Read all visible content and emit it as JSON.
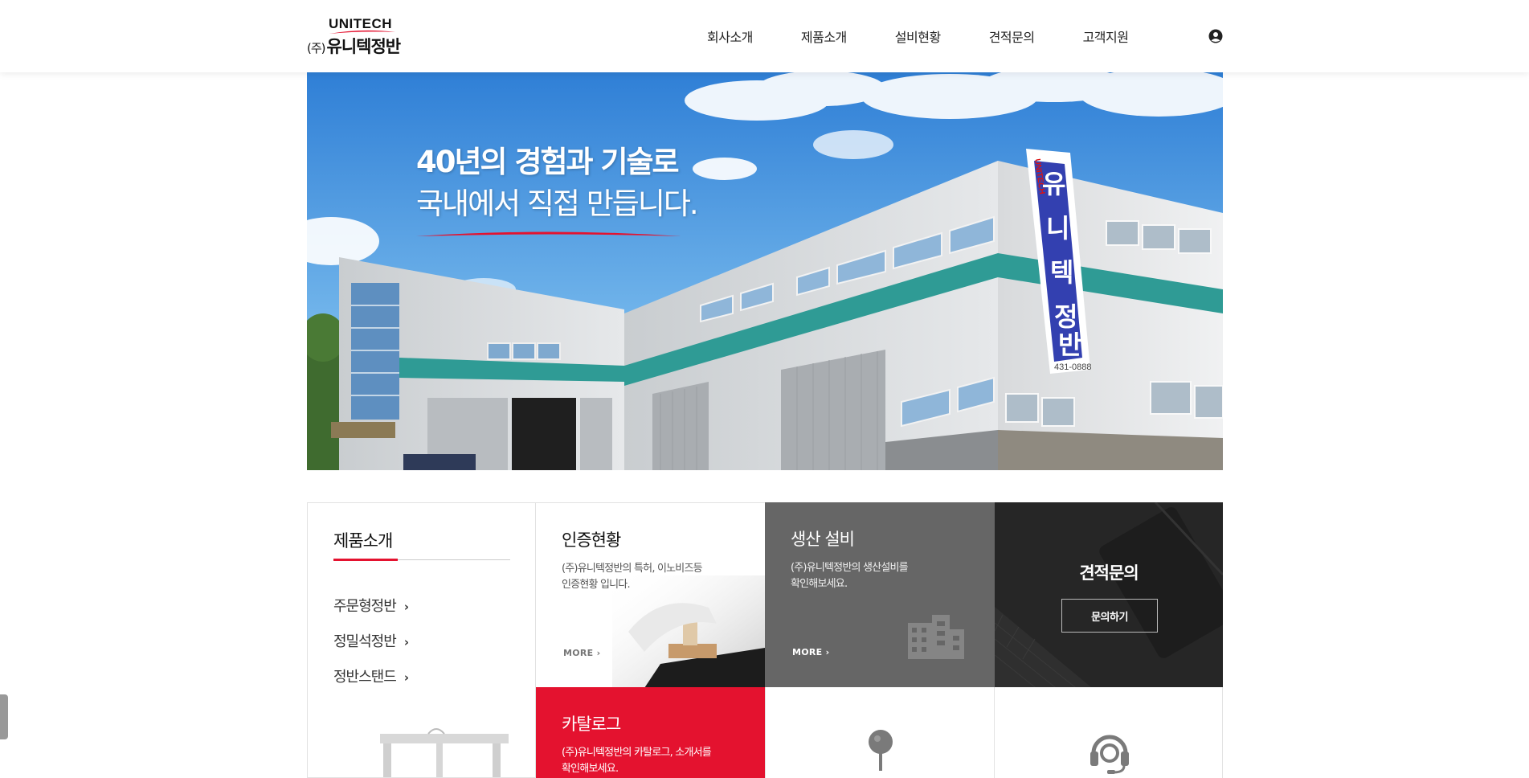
{
  "header": {
    "logo_en": "UNITECH",
    "logo_ko_prefix": "(주)",
    "logo_ko": "유니텍정반",
    "nav": [
      "회사소개",
      "제품소개",
      "설비현황",
      "견적문의",
      "고객지원"
    ],
    "user_icon": "user-circle-icon"
  },
  "hero": {
    "line1": "40년의 경험과 기술로",
    "line2": "국내에서 직접 만듭니다.",
    "sign_text": "유니텍정반",
    "sign_en": "UNITECH",
    "sign_phone": "431-0888"
  },
  "products": {
    "title": "제품소개",
    "items": [
      "주문형정반",
      "정밀석정반",
      "정반스탠드"
    ]
  },
  "cert": {
    "title": "인증현황",
    "desc1": "(주)유니텍정반의 특허, 이노비즈등",
    "desc2": "인증현황 입니다.",
    "more": "MORE"
  },
  "equipment": {
    "title": "생산 설비",
    "desc1": "(주)유니텍정반의 생산설비를",
    "desc2": "확인해보세요.",
    "more": "MORE",
    "icon": "building-icon"
  },
  "quote": {
    "title": "견적문의",
    "button": "문의하기"
  },
  "catalog": {
    "title": "카탈로그",
    "desc1": "(주)유니텍정반의 카탈로그, 소개서를",
    "desc2": "확인해보세요."
  },
  "map": {
    "icon": "map-pin-icon"
  },
  "support": {
    "icon": "headset-icon"
  },
  "colors": {
    "brand_red": "#e4122f",
    "dark": "#222222",
    "gray": "#666666"
  }
}
